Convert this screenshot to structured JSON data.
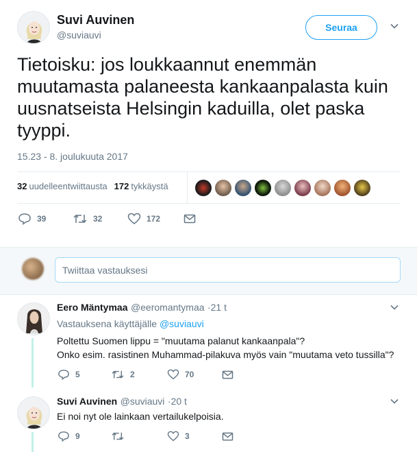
{
  "tweet": {
    "author_name": "Suvi Auvinen",
    "author_handle": "@suviauvi",
    "follow_label": "Seuraa",
    "text": "Tietoisku: jos loukkaannut enemmän muutamasta palaneesta kankaanpalasta kuin uusnatseista Helsingin kaduilla, olet paska tyyppi.",
    "timestamp": "15.23 - 8. joulukuuta 2017",
    "retweets_count": "32",
    "retweets_label": "uudelleentwiittausta",
    "likes_count": "172",
    "likes_label": "tykkäystä",
    "actions": {
      "reply_count": "39",
      "retweet_count": "32",
      "like_count": "172"
    }
  },
  "composer": {
    "placeholder": "Twiittaa vastauksesi"
  },
  "replies": [
    {
      "name": "Eero Mäntymaa",
      "handle": "@eeromantymaa",
      "time": "·21 t",
      "reply_to_prefix": "Vastauksena käyttäjälle",
      "reply_to_handle": "@suviauvi",
      "line1": "Poltettu Suomen lippu = \"muutama palanut kankaanpala\"?",
      "line2": "Onko esim. rasistinen Muhammad-pilakuva myös vain \"muutama veto tussilla\"?",
      "reply_count": "5",
      "retweet_count": "2",
      "like_count": "70"
    },
    {
      "name": "Suvi Auvinen",
      "handle": "@suviauvi",
      "time": "·20 t",
      "line1": "Ei noi nyt ole lainkaan vertailukelpoisia.",
      "reply_count": "9",
      "retweet_count": "",
      "like_count": "3"
    }
  ],
  "colors": {
    "accent": "#1da1f2",
    "muted": "#657786",
    "thread_line": "#c3f0e9"
  }
}
